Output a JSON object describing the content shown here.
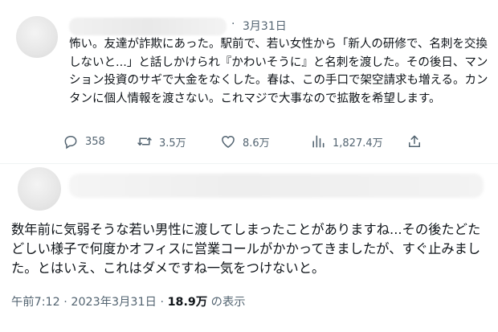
{
  "tweet": {
    "date": "3月31日",
    "separator": "·",
    "text": "怖い。友達が詐欺にあった。駅前で、若い女性から「新人の研修で、名刺を交換しないと...」と話しかけられ『かわいそうに』と名刺を渡した。その後日、マンション投資のサギで大金をなくした。春は、この手口で架空請求も増える。カンタンに個人情報を渡さない。これマジで大事なので拡散を希望します。",
    "actions": {
      "reply_count": "358",
      "retweet_count": "3.5万",
      "like_count": "8.6万",
      "view_count": "1,827.4万",
      "icons": {
        "reply": "reply-icon",
        "retweet": "retweet-icon",
        "like": "heart-icon",
        "views": "views-icon",
        "share": "share-icon"
      }
    }
  },
  "reply": {
    "text": "数年前に気弱そうな若い男性に渡してしまったことがありますね...その後たどたどしい様子で何度かオフィスに営業コールがかかってきましたが、すぐ止みました。とはいえ、これはダメですね一気をつけないと。",
    "time": "午前7:12",
    "dot": " · ",
    "date": "2023年3月31日",
    "views_count": "18.9万",
    "views_label": " の表示"
  },
  "colors": {
    "text": "#0f1419",
    "secondary": "#536471",
    "divider": "#eff3f4"
  }
}
